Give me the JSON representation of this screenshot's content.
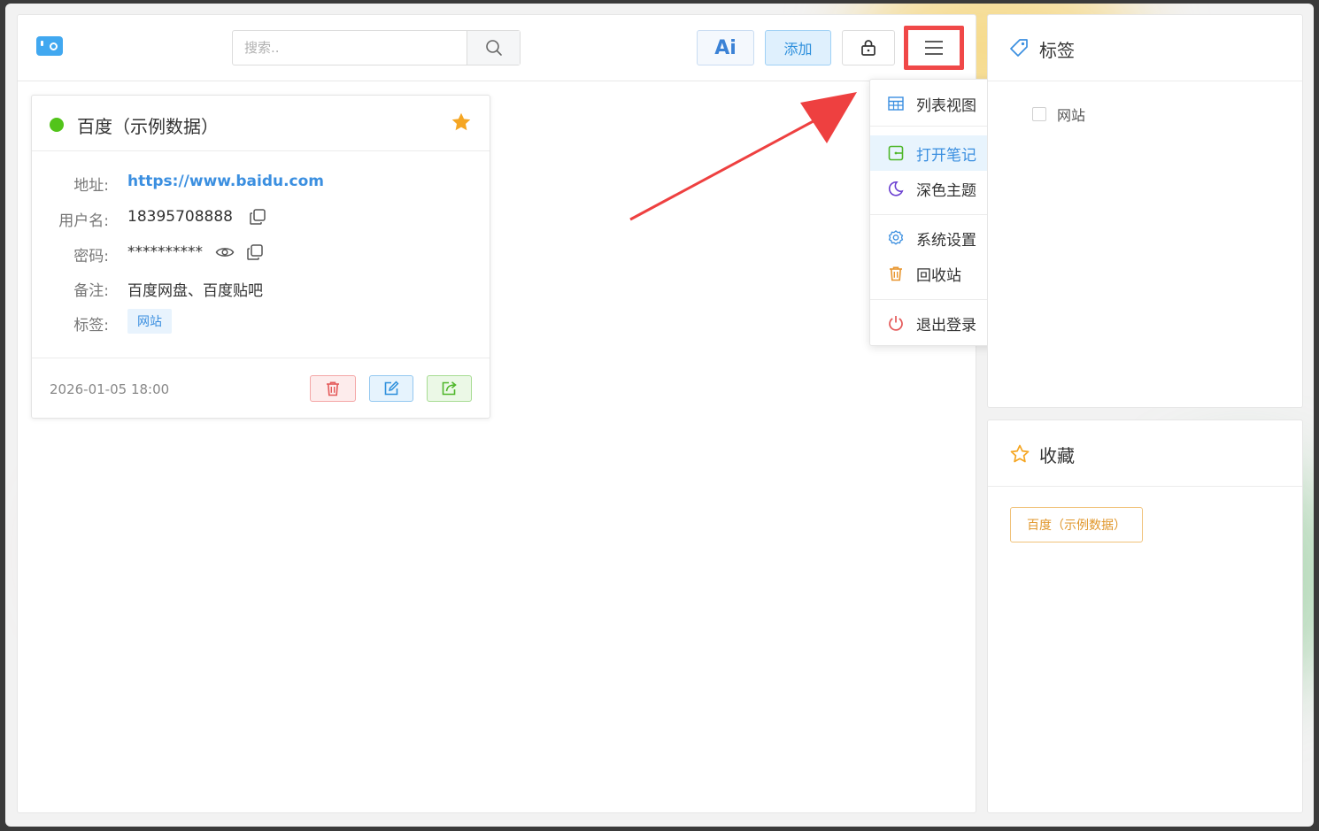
{
  "header": {
    "search_placeholder": "搜索..",
    "ai_label": "Ai",
    "add_label": "添加"
  },
  "card": {
    "title": "百度（示例数据）",
    "fields": {
      "address_label": "地址:",
      "address_value": "https://www.baidu.com",
      "username_label": "用户名:",
      "username_value": "18395708888",
      "password_label": "密码:",
      "password_value": "**********",
      "note_label": "备注:",
      "note_value": "百度网盘、百度贴吧",
      "tag_label": "标签:",
      "tag_value": "网站"
    },
    "date": "2026-01-05 18:00"
  },
  "menu": {
    "items": [
      {
        "label": "列表视图",
        "icon": "table-icon"
      },
      {
        "label": "打开笔记",
        "icon": "note-icon"
      },
      {
        "label": "深色主题",
        "icon": "moon-icon"
      },
      {
        "label": "系统设置",
        "icon": "gear-icon"
      },
      {
        "label": "回收站",
        "icon": "trash-icon"
      },
      {
        "label": "退出登录",
        "icon": "power-icon"
      }
    ]
  },
  "tags_panel": {
    "title": "标签",
    "items": [
      {
        "label": "网站",
        "checked": false
      }
    ]
  },
  "fav_panel": {
    "title": "收藏",
    "items": [
      {
        "label": "百度（示例数据）"
      }
    ]
  },
  "colors": {
    "accent": "#3b8fe0",
    "highlight_box": "#f04848",
    "status_online": "#52c41a",
    "star": "#f5a623"
  }
}
